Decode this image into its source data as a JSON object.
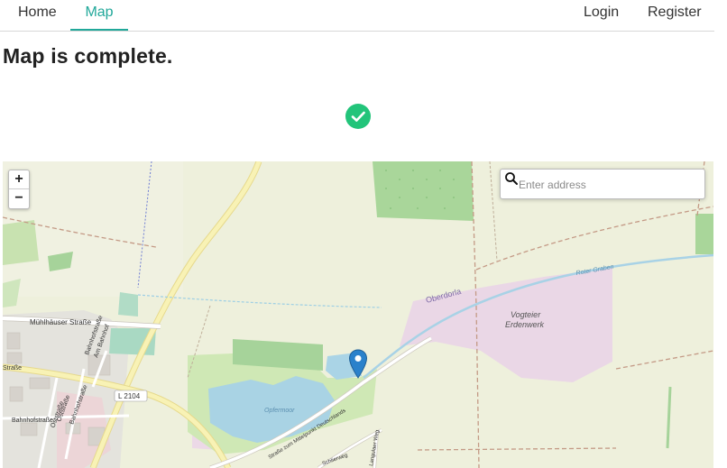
{
  "nav": {
    "home": "Home",
    "map": "Map",
    "login": "Login",
    "register": "Register"
  },
  "page": {
    "title": "Map is complete."
  },
  "status": {
    "icon": "check-circle-icon",
    "color": "#22c47a"
  },
  "map": {
    "zoom_in": "+",
    "zoom_out": "−",
    "search_placeholder": "Enter address",
    "marker_icon": "map-pin-icon",
    "marker_color": "#2a81cb",
    "labels": {
      "muhlhauser": "Mühlhäuser Straße",
      "oststrasse": "Oststraße",
      "bahnhofstrasse_v": "Bahnhofstraße",
      "am_bahnhof": "Am Bahnhof",
      "strasse_left": "Straße",
      "l2104": "L 2104",
      "oststrasse2": "Oststraße",
      "bahnhofstrasse2": "Bahnhofstraße",
      "bahnhofstrasse_h": "Bahnhofstraße",
      "oberdorla": "Oberdorla",
      "vogteier": "Vogteier",
      "erdenwerk": "Erdenwerk",
      "roter_graben": "Roter Graben",
      "opfermoor": "Opfermoor",
      "strasse_mittelpunkt": "Straße zum Mittelpunkt Deutschlands",
      "schlierweg": "Schlierweg",
      "langulaer_weg": "Langulaer Weg"
    }
  }
}
